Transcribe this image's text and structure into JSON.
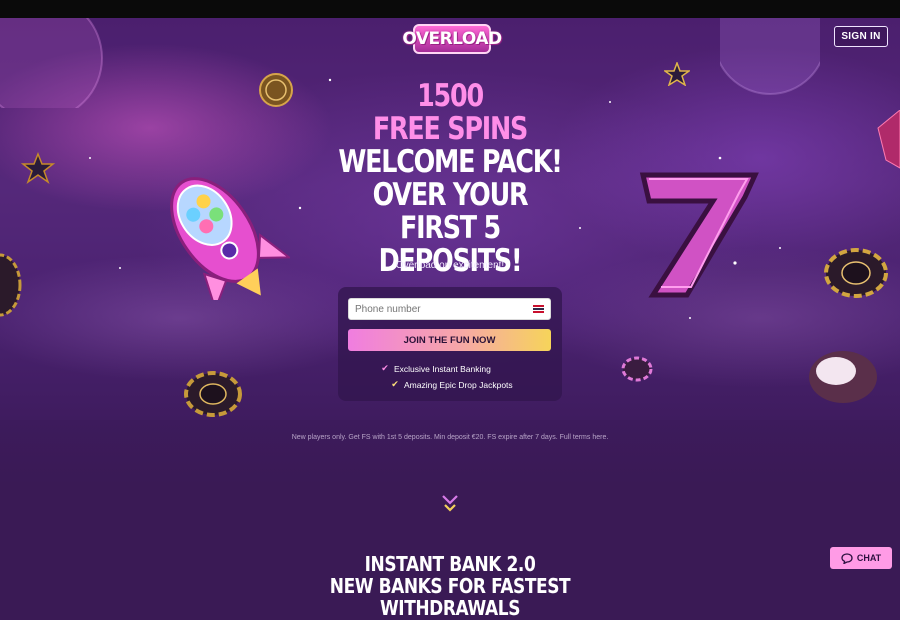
{
  "brand": {
    "logo_text": "OVERLOAD",
    "accent": "#ff8ee8",
    "background": "#3a1a55"
  },
  "header": {
    "signin_label": "SIGN IN"
  },
  "hero": {
    "headline_line1": "1500",
    "headline_line2": "FREE SPINS",
    "headline_line3": "WELCOME PACK!",
    "headline_line4": "OVER YOUR",
    "headline_line5": "FIRST 5 DEPOSITS!",
    "tagline": "Overload on excitement!"
  },
  "signup_form": {
    "phone_placeholder": "Phone number",
    "phone_value": "",
    "join_label": "JOIN THE FUN NOW",
    "features": [
      {
        "label": "Exclusive Instant Banking",
        "icon": "check-icon"
      },
      {
        "label": "Amazing Epic Drop Jackpots",
        "icon": "check-icon"
      }
    ]
  },
  "terms": "New players only. Get FS with 1st 5 deposits. Min deposit €20. FS expire after 7 days. Full terms here.",
  "next_section": {
    "title_line1": "INSTANT BANK 2.0",
    "title_line2": "NEW BANKS FOR FASTEST WITHDRAWALS"
  },
  "chat": {
    "label": "CHAT",
    "icon": "chat-bubble-icon"
  },
  "icons": [
    "scroll-down-icon",
    "flag-icon",
    "check-icon",
    "chat-bubble-icon"
  ]
}
